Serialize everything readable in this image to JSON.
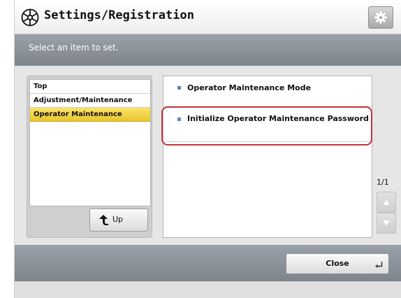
{
  "header": {
    "title": "Settings/Registration",
    "title_icon": "settings-star-icon",
    "settings_button_icon": "gear-icon"
  },
  "banner": {
    "text": "Select an item to set."
  },
  "tree": {
    "items": [
      {
        "label": "Top",
        "selected": false
      },
      {
        "label": "Adjustment/Maintenance",
        "selected": false
      },
      {
        "label": "Operator Maintenance",
        "selected": true
      }
    ],
    "up_button": {
      "label": "Up",
      "icon": "up-arrow-icon"
    }
  },
  "list": {
    "items": [
      {
        "label": "Operator Maintenance Mode",
        "highlighted": false
      },
      {
        "label": "Initialize Operator Maintenance Password",
        "highlighted": true
      }
    ]
  },
  "pager": {
    "indicator": "1/1",
    "up_icon": "triangle-up-icon",
    "down_icon": "triangle-down-icon"
  },
  "footer": {
    "close_label": "Close",
    "close_icon": "return-icon"
  },
  "colors": {
    "selected_item": "#f0d040",
    "highlight_border": "#c8333a",
    "bullet": "#5b86c7",
    "bar": "#8a9199"
  }
}
